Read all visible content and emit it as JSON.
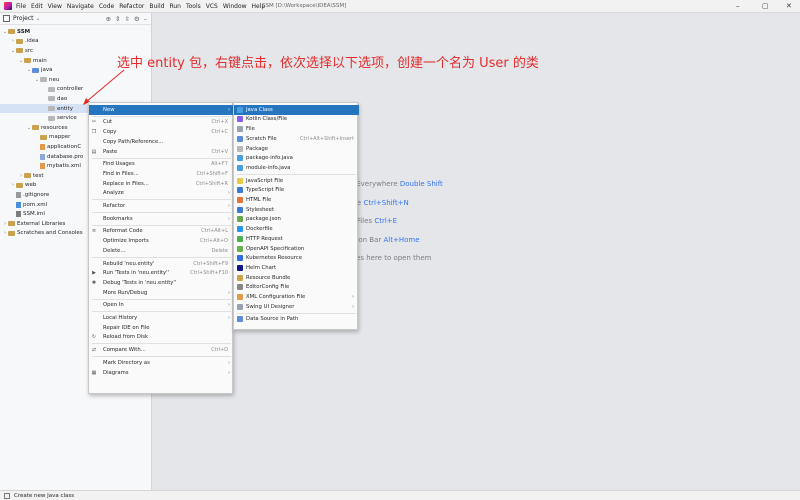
{
  "menubar": [
    "File",
    "Edit",
    "View",
    "Navigate",
    "Code",
    "Refactor",
    "Build",
    "Run",
    "Tools",
    "VCS",
    "Window",
    "Help"
  ],
  "window_title": "SSM [D:\\Workspace\\IDEA\\SSM]",
  "project": {
    "label": "Project",
    "tree": [
      {
        "text": "SSM",
        "indent": 0,
        "chev": "⌄",
        "icon": "fold",
        "bold": true
      },
      {
        "text": ".idea",
        "indent": 1,
        "chev": "›",
        "icon": "fold"
      },
      {
        "text": "src",
        "indent": 1,
        "chev": "⌄",
        "icon": "fold"
      },
      {
        "text": "main",
        "indent": 2,
        "chev": "⌄",
        "icon": "fold"
      },
      {
        "text": "java",
        "indent": 3,
        "chev": "⌄",
        "icon": "fold blue"
      },
      {
        "text": "neu",
        "indent": 4,
        "chev": "⌄",
        "icon": "fold pkg"
      },
      {
        "text": "controller",
        "indent": 5,
        "chev": "",
        "icon": "fold pkg"
      },
      {
        "text": "dao",
        "indent": 5,
        "chev": "",
        "icon": "fold pkg"
      },
      {
        "text": "entity",
        "indent": 5,
        "chev": "",
        "icon": "fold pkg",
        "selected": true
      },
      {
        "text": "service",
        "indent": 5,
        "chev": "",
        "icon": "fold pkg"
      },
      {
        "text": "resources",
        "indent": 3,
        "chev": "⌄",
        "icon": "fold res"
      },
      {
        "text": "mapper",
        "indent": 4,
        "chev": "",
        "icon": "fold"
      },
      {
        "text": "applicationC",
        "indent": 4,
        "chev": "",
        "icon": "file xml"
      },
      {
        "text": "database.pro",
        "indent": 4,
        "chev": "",
        "icon": "file"
      },
      {
        "text": "mybatis.xml",
        "indent": 4,
        "chev": "",
        "icon": "file xml"
      },
      {
        "text": "test",
        "indent": 2,
        "chev": "›",
        "icon": "fold"
      },
      {
        "text": "web",
        "indent": 1,
        "chev": "›",
        "icon": "fold"
      },
      {
        "text": ".gitignore",
        "indent": 1,
        "chev": "",
        "icon": "file git"
      },
      {
        "text": "pom.xml",
        "indent": 1,
        "chev": "",
        "icon": "file m"
      },
      {
        "text": "SSM.iml",
        "indent": 1,
        "chev": "",
        "icon": "file iml"
      },
      {
        "text": "External Libraries",
        "indent": 0,
        "chev": "›",
        "icon": "fold"
      },
      {
        "text": "Scratches and Consoles",
        "indent": 0,
        "chev": "›",
        "icon": "fold"
      }
    ]
  },
  "annotation": "选中 entity 包，右键点击，依次选择以下选项，创建一个名为 User 的类",
  "marker1": "①",
  "marker2": "②",
  "editor_hints": [
    {
      "pre": "rch Everywhere ",
      "key": "Double Shift"
    },
    {
      "pre": "o File ",
      "key": "Ctrl+Shift+N"
    },
    {
      "pre": "ent Files ",
      "key": "Ctrl+E"
    },
    {
      "pre": "igation Bar ",
      "key": "Alt+Home"
    },
    {
      "pre": "p files here to open them",
      "key": ""
    }
  ],
  "context_menu": [
    {
      "label": "New",
      "sc": "",
      "arrow": true,
      "active": true,
      "icon": ""
    },
    {
      "sep": true
    },
    {
      "label": "Cut",
      "sc": "Ctrl+X",
      "icon": "✂"
    },
    {
      "label": "Copy",
      "sc": "Ctrl+C",
      "icon": "❐"
    },
    {
      "label": "Copy Path/Reference...",
      "sc": "",
      "icon": ""
    },
    {
      "label": "Paste",
      "sc": "Ctrl+V",
      "icon": "▤"
    },
    {
      "sep": true
    },
    {
      "label": "Find Usages",
      "sc": "Alt+F7",
      "icon": ""
    },
    {
      "label": "Find in Files...",
      "sc": "Ctrl+Shift+F",
      "icon": ""
    },
    {
      "label": "Replace in Files...",
      "sc": "Ctrl+Shift+R",
      "icon": ""
    },
    {
      "label": "Analyze",
      "sc": "",
      "arrow": true,
      "icon": ""
    },
    {
      "sep": true
    },
    {
      "label": "Refactor",
      "sc": "",
      "arrow": true,
      "icon": ""
    },
    {
      "sep": true
    },
    {
      "label": "Bookmarks",
      "sc": "",
      "arrow": true,
      "icon": ""
    },
    {
      "sep": true
    },
    {
      "label": "Reformat Code",
      "sc": "Ctrl+Alt+L",
      "icon": "≡"
    },
    {
      "label": "Optimize Imports",
      "sc": "Ctrl+Alt+O",
      "icon": ""
    },
    {
      "label": "Delete...",
      "sc": "Delete",
      "icon": ""
    },
    {
      "sep": true
    },
    {
      "label": "Rebuild 'neu.entity'",
      "sc": "Ctrl+Shift+F9",
      "icon": ""
    },
    {
      "label": "Run 'Tests in 'neu.entity''",
      "sc": "Ctrl+Shift+F10",
      "icon": "▶"
    },
    {
      "label": "Debug 'Tests in 'neu.entity''",
      "sc": "",
      "icon": "✱"
    },
    {
      "label": "More Run/Debug",
      "sc": "",
      "arrow": true,
      "icon": ""
    },
    {
      "sep": true
    },
    {
      "label": "Open In",
      "sc": "",
      "arrow": true,
      "icon": ""
    },
    {
      "sep": true
    },
    {
      "label": "Local History",
      "sc": "",
      "arrow": true,
      "icon": ""
    },
    {
      "label": "Repair IDE on File",
      "sc": "",
      "icon": ""
    },
    {
      "label": "Reload from Disk",
      "sc": "",
      "icon": "↻"
    },
    {
      "sep": true
    },
    {
      "label": "Compare With...",
      "sc": "Ctrl+D",
      "icon": "⇄"
    },
    {
      "sep": true
    },
    {
      "label": "Mark Directory as",
      "sc": "",
      "arrow": true,
      "icon": ""
    },
    {
      "label": "Diagrams",
      "sc": "",
      "arrow": true,
      "icon": "▦"
    }
  ],
  "submenu": [
    {
      "label": "Java Class",
      "sc": "",
      "color": "#4a9fe0",
      "active": true
    },
    {
      "label": "Kotlin Class/File",
      "sc": "",
      "color": "#8a5cf0"
    },
    {
      "label": "File",
      "sc": "",
      "color": "#9aa4b0"
    },
    {
      "label": "Scratch File",
      "sc": "Ctrl+Alt+Shift+Insert",
      "color": "#5b8ed6"
    },
    {
      "label": "Package",
      "sc": "",
      "color": "#b7b7b7"
    },
    {
      "label": "package-info.java",
      "sc": "",
      "color": "#4a9fe0"
    },
    {
      "label": "module-info.java",
      "sc": "",
      "color": "#4a9fe0"
    },
    {
      "sep": true
    },
    {
      "label": "JavaScript File",
      "sc": "",
      "color": "#e8c94a"
    },
    {
      "label": "TypeScript File",
      "sc": "",
      "color": "#3a7bd5"
    },
    {
      "label": "HTML File",
      "sc": "",
      "color": "#e0773a"
    },
    {
      "label": "Stylesheet",
      "sc": "",
      "color": "#3a7bd5"
    },
    {
      "label": "package.json",
      "sc": "",
      "color": "#6aa84f"
    },
    {
      "label": "Dockerfile",
      "sc": "",
      "color": "#2496ed"
    },
    {
      "label": "HTTP Request",
      "sc": "",
      "color": "#4caf50"
    },
    {
      "label": "OpenAPI Specification",
      "sc": "",
      "color": "#6ab04c"
    },
    {
      "label": "Kubernetes Resource",
      "sc": "",
      "color": "#326ce5"
    },
    {
      "label": "Helm Chart",
      "sc": "",
      "color": "#0f1689"
    },
    {
      "label": "Resource Bundle",
      "sc": "",
      "color": "#c9a24b"
    },
    {
      "label": "EditorConfig File",
      "sc": "",
      "color": "#888888"
    },
    {
      "label": "XML Configuration File",
      "sc": "",
      "color": "#e39a4a",
      "arrow": true
    },
    {
      "label": "Swing UI Designer",
      "sc": "",
      "color": "#9aa4b0",
      "arrow": true
    },
    {
      "sep": true
    },
    {
      "label": "Data Source in Path",
      "sc": "",
      "color": "#5b8ed6"
    }
  ],
  "status_text": "Create new Java class"
}
